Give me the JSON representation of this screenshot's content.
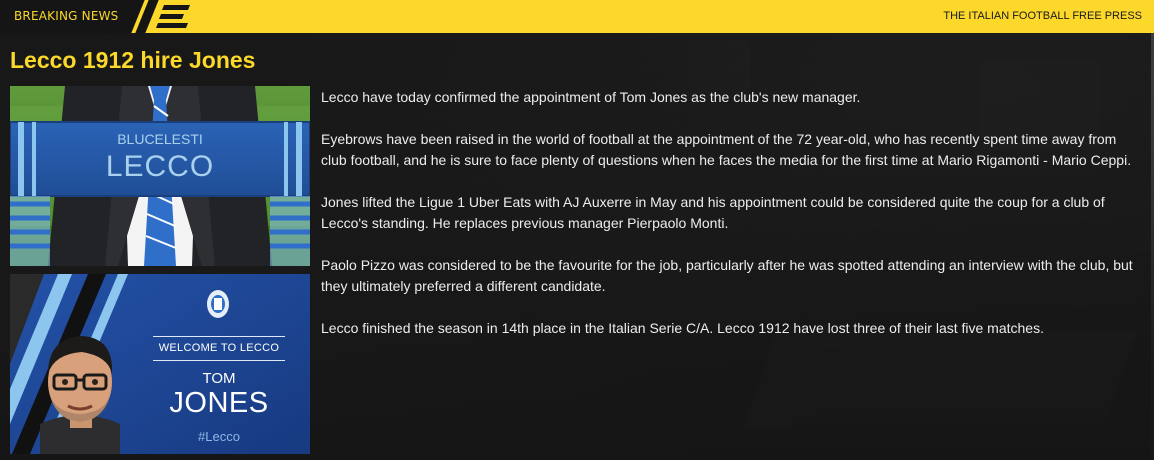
{
  "header": {
    "breaking_label": "BREAKING NEWS",
    "publication": "THE ITALIAN FOOTBALL FREE PRESS"
  },
  "article": {
    "headline": "Lecco 1912 hire Jones",
    "paragraphs": [
      "Lecco have today confirmed the appointment of Tom Jones as the club's new manager.",
      "Eyebrows have been raised in the world of football at the appointment of the 72 year-old, who has recently spent time away from club football, and he is sure to face plenty of questions when he faces the media for the first time at Mario Rigamonti - Mario Ceppi.",
      "Jones lifted the Ligue 1 Uber Eats with AJ Auxerre in May and his appointment could be considered quite the coup for a club of Lecco's standing. He replaces previous manager Pierpaolo Monti.",
      "Paolo Pizzo was considered to be the favourite for the job, particularly after he was spotted attending an interview with the club, but they ultimately preferred a different candidate.",
      "Lecco finished the season in 14th place in the Italian Serie C/A. Lecco 1912 have lost three of their last five matches."
    ]
  },
  "images": {
    "scarf": {
      "line1": "BLUCELESTI",
      "line2": "LECCO"
    },
    "welcome": {
      "label": "WELCOME TO LECCO",
      "first_name": "TOM",
      "last_name": "JONES",
      "hashtag": "#Lecco"
    }
  },
  "colors": {
    "accent_yellow": "#fbd829",
    "header_dark": "#151515",
    "panel_bg": "#161616",
    "club_blue": "#2f6fc9",
    "club_light_blue": "#a9d1ee"
  }
}
